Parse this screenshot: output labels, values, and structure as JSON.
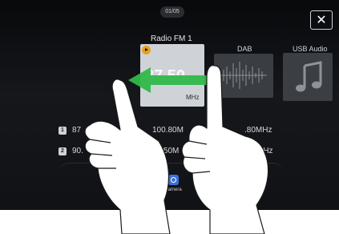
{
  "page_indicator": "01/05",
  "close_label": "✕",
  "sources": {
    "radio": {
      "label": "Radio FM 1",
      "frequency": "87.50",
      "unit": "MHz"
    },
    "dab": {
      "label": "DAB"
    },
    "usb": {
      "label": "USB Audio"
    }
  },
  "presets": [
    {
      "num": "1",
      "text": "87"
    },
    {
      "num": "2",
      "text": "90."
    },
    {
      "num": "",
      "text": "100.80M"
    },
    {
      "num": "",
      "text": "88.50M"
    },
    {
      "num": "",
      "text": ".80MHz"
    },
    {
      "num": "",
      "text": "MHz"
    }
  ],
  "camera": {
    "label": "Camera"
  },
  "colors": {
    "swipe_arrow": "#2fb84a",
    "play_icon": "#e6a21e",
    "camera_icon": "#3d6fd8"
  },
  "gesture": {
    "direction": "left",
    "fingers": "hands-swipe-gesture"
  }
}
